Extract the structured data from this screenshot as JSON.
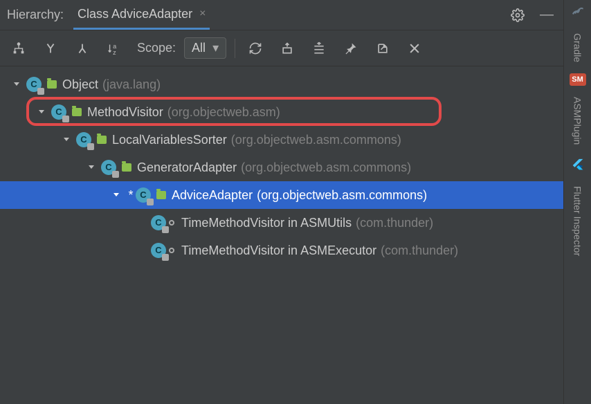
{
  "header": {
    "title_label": "Hierarchy:",
    "tab_label": "Class AdviceAdapter"
  },
  "toolbar": {
    "scope_label": "Scope:",
    "scope_value": "All"
  },
  "right_tabs": {
    "gradle": "Gradle",
    "asm": "ASMPlugin",
    "flutter": "Flutter Inspector"
  },
  "tree": [
    {
      "indent": 0,
      "expander": true,
      "name": "Object",
      "pkg": "(java.lang)",
      "asterisk": false,
      "selected": false,
      "highlighted": false,
      "class_icon": true,
      "bullet": false
    },
    {
      "indent": 1,
      "expander": true,
      "name": "MethodVisitor",
      "pkg": "(org.objectweb.asm)",
      "asterisk": false,
      "selected": false,
      "highlighted": true,
      "class_icon": true,
      "bullet": false
    },
    {
      "indent": 2,
      "expander": true,
      "name": "LocalVariablesSorter",
      "pkg": "(org.objectweb.asm.commons)",
      "asterisk": false,
      "selected": false,
      "highlighted": false,
      "class_icon": true,
      "bullet": false
    },
    {
      "indent": 3,
      "expander": true,
      "name": "GeneratorAdapter",
      "pkg": "(org.objectweb.asm.commons)",
      "asterisk": false,
      "selected": false,
      "highlighted": false,
      "class_icon": true,
      "bullet": false
    },
    {
      "indent": 4,
      "expander": true,
      "name": "AdviceAdapter",
      "pkg": "(org.objectweb.asm.commons)",
      "asterisk": true,
      "selected": true,
      "highlighted": false,
      "class_icon": true,
      "bullet": false
    },
    {
      "indent": 5,
      "expander": false,
      "name": "TimeMethodVisitor in ASMUtils",
      "pkg": "(com.thunder)",
      "asterisk": false,
      "selected": false,
      "highlighted": false,
      "class_icon": true,
      "bullet": true
    },
    {
      "indent": 5,
      "expander": false,
      "name": "TimeMethodVisitor in ASMExecutor",
      "pkg": "(com.thunder)",
      "asterisk": false,
      "selected": false,
      "highlighted": false,
      "class_icon": true,
      "bullet": true
    }
  ]
}
